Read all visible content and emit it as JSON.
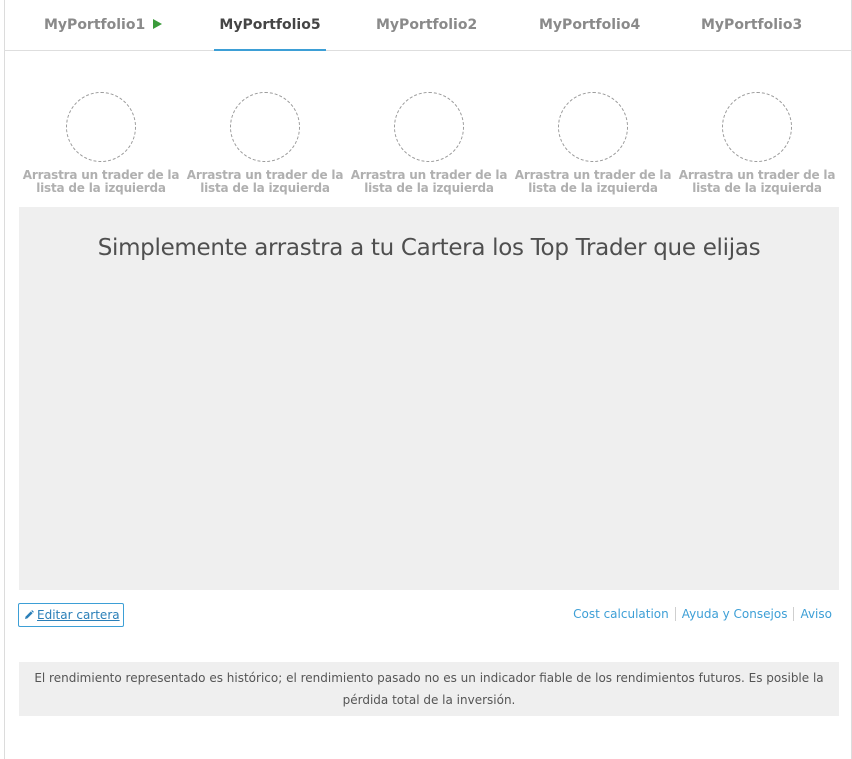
{
  "tabs": [
    {
      "label": "MyPortfolio1",
      "playing": true
    },
    {
      "label": "MyPortfolio5",
      "active": true
    },
    {
      "label": "MyPortfolio2"
    },
    {
      "label": "MyPortfolio4"
    },
    {
      "label": "MyPortfolio3"
    }
  ],
  "slots": [
    {
      "label": "Arrastra un trader de la lista de la izquierda"
    },
    {
      "label": "Arrastra un trader de la lista de la izquierda"
    },
    {
      "label": "Arrastra un trader de la lista de la izquierda"
    },
    {
      "label": "Arrastra un trader de la lista de la izquierda"
    },
    {
      "label": "Arrastra un trader de la lista de la izquierda"
    }
  ],
  "main": {
    "title": "Simplemente arrastra a tu Cartera los Top Trader que elijas"
  },
  "edit_button": {
    "label": "Editar cartera"
  },
  "links": [
    "Cost calculation",
    "Ayuda y Consejos",
    "Aviso"
  ],
  "disclaimer": "El rendimiento representado es histórico; el rendimiento pasado no es un indicador fiable de los rendimientos futuros. Es posible la pérdida total de la inversión.",
  "colors": {
    "accent": "#3d9fd6",
    "play": "#3a9b3a"
  }
}
